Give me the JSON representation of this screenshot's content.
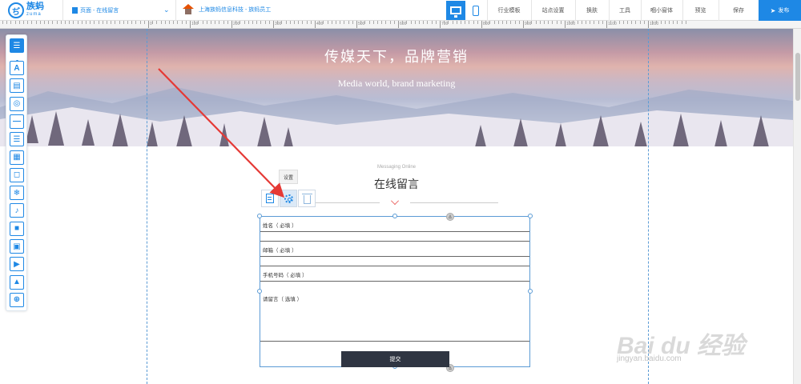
{
  "topbar": {
    "logo_glyph": "ぢ",
    "logo_text": "族蚂",
    "logo_sub": "zuma",
    "page_selector": "页面 - 在线留言",
    "site_name": "上海族蚂信息科技 - 族蚂员工",
    "buttons": {
      "industry_template": "行业模板",
      "site_settings": "站点设置",
      "skin": "换肤",
      "tools": "工具",
      "mini_window": "嗰小窗体",
      "preview": "预览",
      "save": "保存",
      "publish": "发布"
    }
  },
  "ruler": {
    "labels": [
      "0",
      "100",
      "200",
      "300",
      "400",
      "500",
      "600",
      "700",
      "800",
      "900",
      "1000",
      "1100",
      "1200"
    ]
  },
  "banner": {
    "title": "传媒天下，品牌营销",
    "subtitle": "Media world, brand marketing"
  },
  "sidebar": {
    "items": [
      {
        "icon": "list-icon",
        "glyph": "☰"
      },
      {
        "icon": "text-icon",
        "glyph": "A"
      },
      {
        "icon": "image-text-icon",
        "glyph": "▤"
      },
      {
        "icon": "shapes-icon",
        "glyph": "◎"
      },
      {
        "icon": "divider-icon",
        "glyph": "—"
      },
      {
        "icon": "list-icon",
        "glyph": "☰"
      },
      {
        "icon": "gallery-icon",
        "glyph": "▦"
      },
      {
        "icon": "bag-icon",
        "glyph": "◻"
      },
      {
        "icon": "snowflake-icon",
        "glyph": "❄"
      },
      {
        "icon": "music-icon",
        "glyph": "♪"
      },
      {
        "icon": "video-icon",
        "glyph": "■"
      },
      {
        "icon": "form-icon",
        "glyph": "▣"
      },
      {
        "icon": "play-icon",
        "glyph": "▶"
      },
      {
        "icon": "picture-icon",
        "glyph": "▲"
      },
      {
        "icon": "search-icon",
        "glyph": "⊕"
      }
    ]
  },
  "message_section": {
    "eyebrow": "Messaging Online",
    "title": "在线留言",
    "tooltip": "设置"
  },
  "form": {
    "fields": [
      {
        "label": "姓名（ 必填 ）"
      },
      {
        "label": "邮箱（ 必填 ）"
      },
      {
        "label": "手机号码（ 必填 ）"
      },
      {
        "label": "请留言（ 选填 ）"
      }
    ],
    "submit": "提交"
  },
  "watermark": {
    "brand": "Bai du 经验",
    "url": "jingyan.baidu.com"
  },
  "colors": {
    "accent": "#1e88e5",
    "arrow": "#e53935",
    "submit_bg": "#2f3542"
  }
}
